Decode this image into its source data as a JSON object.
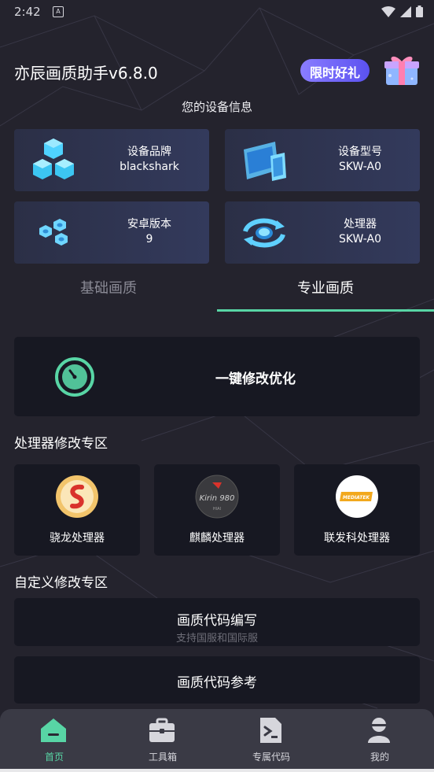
{
  "status_bar": {
    "time": "2:42",
    "notification_icon": "A"
  },
  "header": {
    "app_title": "亦辰画质助手v6.8.0",
    "promo_label": "限时好礼"
  },
  "device_info": {
    "heading": "您的设备信息",
    "cards": [
      {
        "label": "设备品牌",
        "value": "blackshark",
        "icon": "cubes-icon"
      },
      {
        "label": "设备型号",
        "value": "SKW-A0",
        "icon": "devices-icon"
      },
      {
        "label": "安卓版本",
        "value": "9",
        "icon": "nuts-icon"
      },
      {
        "label": "处理器",
        "value": "SKW-A0",
        "icon": "refresh-coin-icon"
      }
    ]
  },
  "tabs": {
    "basic": "基础画质",
    "pro": "专业画质",
    "active": "pro"
  },
  "optimize": {
    "label": "一键修改优化"
  },
  "processor_section": {
    "title": "处理器修改专区",
    "items": [
      {
        "label": "骁龙处理器",
        "logo": "snapdragon-logo"
      },
      {
        "label": "麒麟处理器",
        "logo": "kirin-logo",
        "logo_text": "Kirin 980",
        "logo_subtext": "HIAI"
      },
      {
        "label": "联发科处理器",
        "logo": "mediatek-logo",
        "logo_text": "MEDIATEK"
      }
    ]
  },
  "custom_section": {
    "title": "自定义修改专区",
    "code_write": {
      "label": "画质代码编写",
      "sub": "支持国服和国际服"
    },
    "code_ref": {
      "label": "画质代码参考"
    }
  },
  "bottom_nav": {
    "items": [
      {
        "label": "首页",
        "icon": "home-icon",
        "active": true
      },
      {
        "label": "工具箱",
        "icon": "toolbox-icon",
        "active": false
      },
      {
        "label": "专属代码",
        "icon": "code-file-icon",
        "active": false
      },
      {
        "label": "我的",
        "icon": "user-icon",
        "active": false
      }
    ]
  },
  "colors": {
    "accent": "#58d5a5",
    "promo": "#6a5ff5",
    "background": "#24232d",
    "card": "#171822"
  }
}
